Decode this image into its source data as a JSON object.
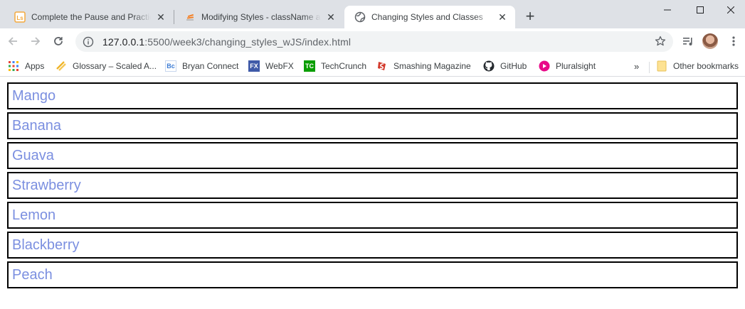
{
  "browser": {
    "tabs": [
      {
        "title": "Complete the Pause and Practice",
        "favicon": "ls-icon",
        "favicon_color": "#f4a93d"
      },
      {
        "title": "Modifying Styles - className and",
        "favicon": "stack-icon",
        "favicon_color": "#f48024"
      },
      {
        "title": "Changing Styles and Classes",
        "favicon": "globe-icon",
        "active": true
      }
    ],
    "new_tab": "+",
    "url": {
      "host": "127.0.0.1",
      "path": ":5500/week3/changing_styles_wJS/index.html"
    },
    "bookmarks": [
      {
        "label": "Apps",
        "icon": "apps-grid-icon"
      },
      {
        "label": "Glossary – Scaled A...",
        "icon": "glossary-icon",
        "color": "#f0b429"
      },
      {
        "label": "Bryan Connect",
        "icon": "bc-icon",
        "icon_text": "Bc",
        "color": "#3a7bd5"
      },
      {
        "label": "WebFX",
        "icon": "fx-icon",
        "icon_text": "FX",
        "color": "#3f5aa8"
      },
      {
        "label": "TechCrunch",
        "icon": "tc-icon",
        "icon_text": "TC",
        "color": "#0a9e01"
      },
      {
        "label": "Smashing Magazine",
        "icon": "smashing-icon",
        "color": "#d33a2c"
      },
      {
        "label": "GitHub",
        "icon": "github-icon",
        "color": "#24292e"
      },
      {
        "label": "Pluralsight",
        "icon": "pluralsight-icon",
        "color": "#e80a89"
      }
    ],
    "overflow": "»",
    "other_bookmarks": "Other bookmarks"
  },
  "page": {
    "fruit_color": "#7b8fe0",
    "fruits": [
      "Mango",
      "Banana",
      "Guava",
      "Strawberry",
      "Lemon",
      "Blackberry",
      "Peach"
    ]
  }
}
